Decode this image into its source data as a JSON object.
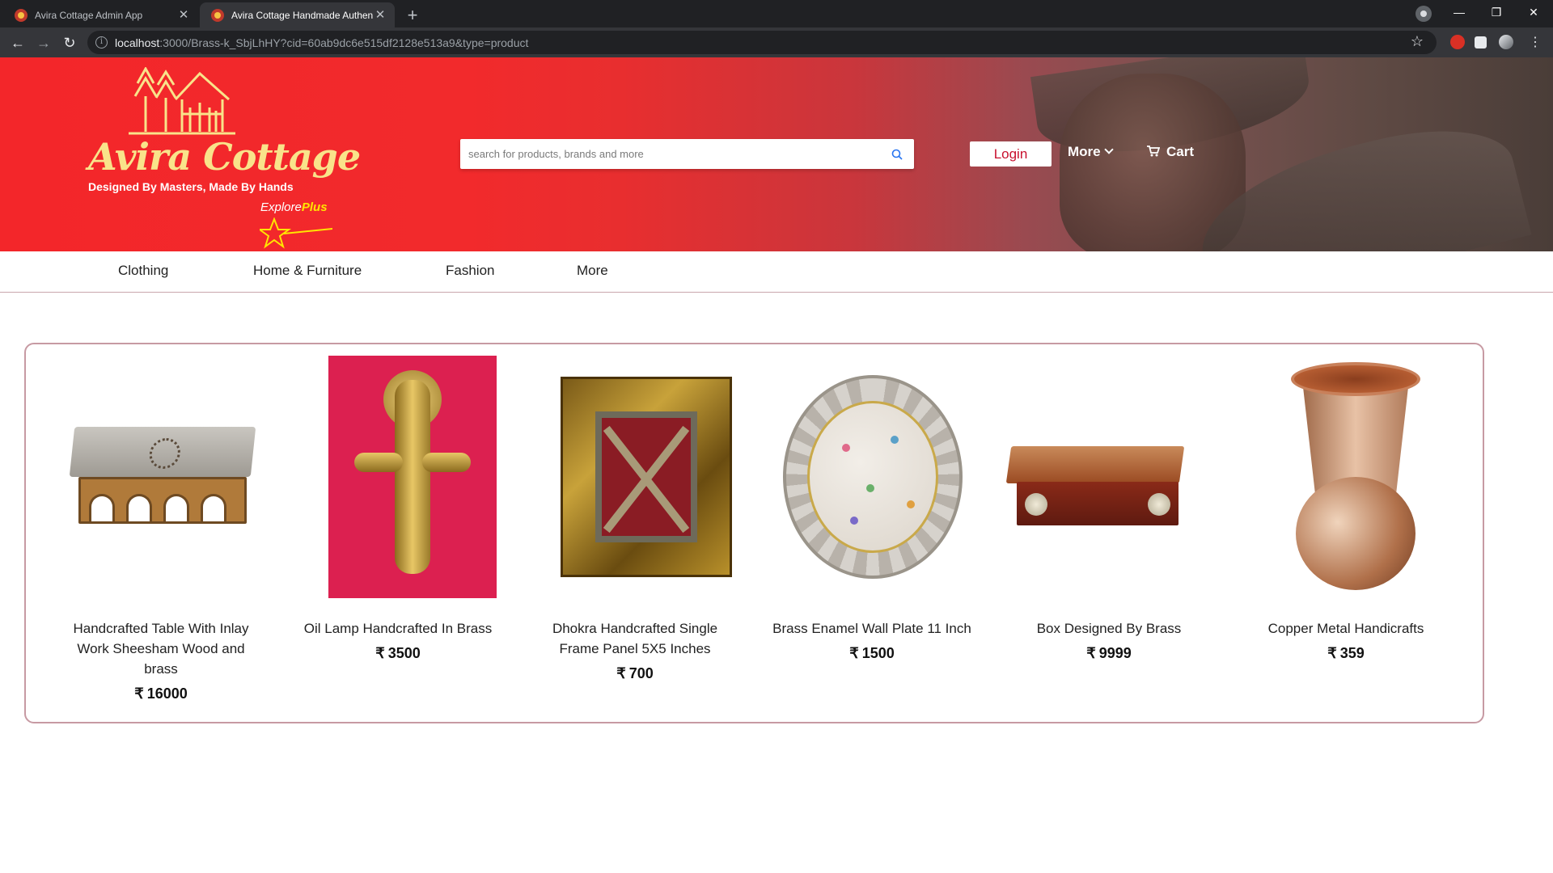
{
  "browser": {
    "tabs": [
      {
        "title": "Avira Cottage Admin App",
        "active": false
      },
      {
        "title": "Avira Cottage Handmade Authen",
        "active": true
      }
    ],
    "url_host": "localhost",
    "url_rest": ":3000/Brass-k_SbjLhHY?cid=60ab9dc6e515df2128e513a9&type=product",
    "extensions": [
      "abp-icon",
      "puzzle-icon",
      "profile-avatar"
    ]
  },
  "header": {
    "logo_name": "Avira Cottage",
    "logo_tagline": "Designed By Masters, Made By Hands",
    "logo_explore": "Explore",
    "logo_plus": "Plus",
    "search_placeholder": "search for products, brands and more",
    "login_label": "Login",
    "more_label": "More",
    "cart_label": "Cart",
    "colors": {
      "brand_red": "#f3262a",
      "login_text": "#c8102e",
      "plus_yellow": "#ffe500"
    }
  },
  "categories": [
    "Clothing",
    "Home & Furniture",
    "Fashion",
    "More"
  ],
  "products": [
    {
      "name": "Handcrafted Table With Inlay Work Sheesham Wood and brass",
      "currency": "₹",
      "price": "16000"
    },
    {
      "name": "Oil Lamp Handcrafted In Brass",
      "currency": "₹",
      "price": "3500"
    },
    {
      "name": "Dhokra Handcrafted Single Frame Panel 5X5 Inches",
      "currency": "₹",
      "price": "700"
    },
    {
      "name": "Brass Enamel Wall Plate 11 Inch",
      "currency": "₹",
      "price": "1500"
    },
    {
      "name": "Box Designed By Brass",
      "currency": "₹",
      "price": "9999"
    },
    {
      "name": "Copper Metal Handicrafts",
      "currency": "₹",
      "price": "359"
    }
  ]
}
